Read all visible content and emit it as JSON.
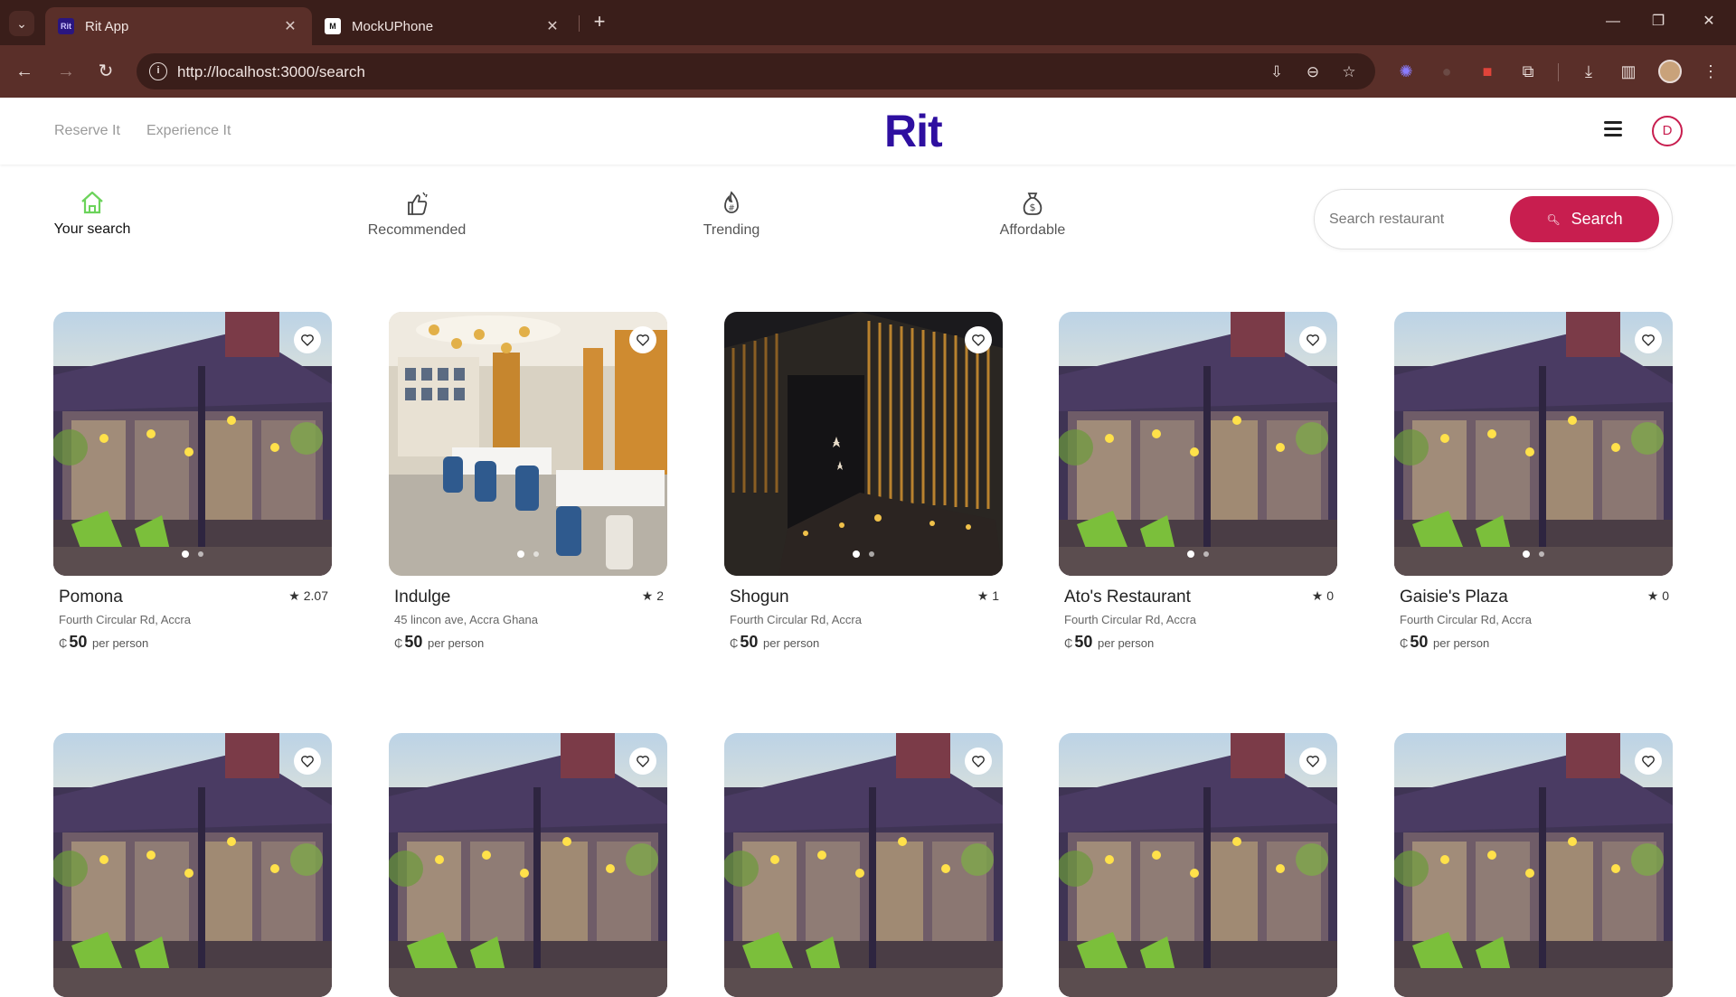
{
  "browser": {
    "tabs": [
      {
        "title": "Rit App",
        "favicon": "Rit",
        "active": true
      },
      {
        "title": "MockUPhone",
        "favicon": "M",
        "active": false
      }
    ],
    "url": "http://localhost:3000/search"
  },
  "header": {
    "links": [
      "Reserve It",
      "Experience It"
    ],
    "logo": "Rit",
    "avatar_initial": "D"
  },
  "categories": [
    {
      "label": "Your search",
      "icon": "home-icon",
      "active": true
    },
    {
      "label": "Recommended",
      "icon": "thumbs-up-icon",
      "active": false
    },
    {
      "label": "Trending",
      "icon": "trending-icon",
      "active": false
    },
    {
      "label": "Affordable",
      "icon": "money-bag-icon",
      "active": false
    }
  ],
  "search": {
    "placeholder": "Search restaurant",
    "button_label": "Search"
  },
  "currency_symbol": "₵",
  "price_suffix": "per person",
  "restaurants": [
    {
      "name": "Pomona",
      "rating": "2.07",
      "address": "Fourth Circular Rd, Accra",
      "price": "50",
      "image": "facade"
    },
    {
      "name": "Indulge",
      "rating": "2",
      "address": "45 lincon ave, Accra Ghana",
      "price": "50",
      "image": "interior"
    },
    {
      "name": "Shogun",
      "rating": "1",
      "address": "Fourth Circular Rd, Accra",
      "price": "50",
      "image": "night"
    },
    {
      "name": "Ato's Restaurant",
      "rating": "0",
      "address": "Fourth Circular Rd, Accra",
      "price": "50",
      "image": "facade"
    },
    {
      "name": "Gaisie's Plaza",
      "rating": "0",
      "address": "Fourth Circular Rd, Accra",
      "price": "50",
      "image": "facade"
    }
  ],
  "colors": {
    "brand": "#2e0fa0",
    "accent": "#c81e4f",
    "active_category": "#6bd35a"
  }
}
